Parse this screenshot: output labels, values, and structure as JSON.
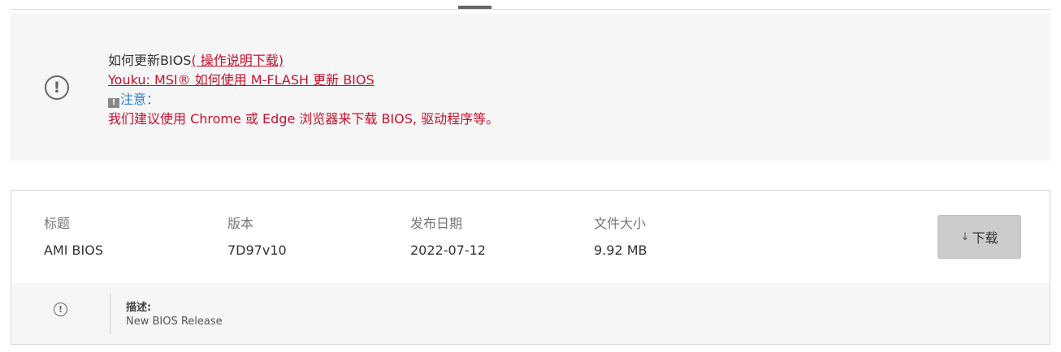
{
  "notice": {
    "icon": "exclamation-circle-icon",
    "line1_text": "如何更新BIOS",
    "line1_link": "( 操作说明下载)",
    "line2_link": "Youku: MSI® 如何使用 M-FLASH 更新 BIOS",
    "warn_icon_glyph": "!",
    "warn_label": "注意：",
    "line4": "我们建议使用 Chrome 或 Edge 浏览器来下载 BIOS, 驱动程序等。"
  },
  "download_item": {
    "headers": {
      "title": "标题",
      "version": "版本",
      "release_date": "发布日期",
      "file_size": "文件大小"
    },
    "values": {
      "title": "AMI BIOS",
      "version": "7D97v10",
      "release_date": "2022-07-12",
      "file_size": "9.92 MB"
    },
    "button": {
      "arrow": "↓",
      "label": "下载",
      "icon": "download-arrow-icon"
    },
    "description": {
      "icon": "exclamation-circle-icon",
      "label": "描述:",
      "text": "New BIOS Release"
    }
  },
  "colors": {
    "accent_red": "#c8102e",
    "notice_blue": "#2e7fd6",
    "panel_bg": "#f6f6f6"
  }
}
